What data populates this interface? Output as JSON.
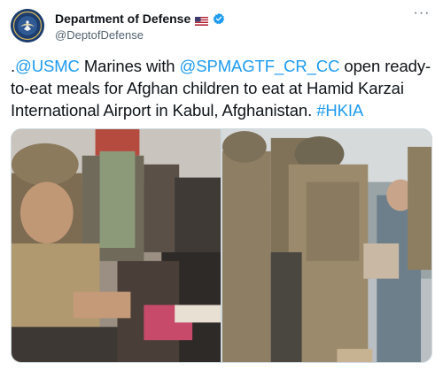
{
  "account": {
    "display_name": "Department of Defense",
    "handle": "@DeptofDefense",
    "avatar_icon": "dod-seal-icon",
    "flag_icon": "us-flag-icon",
    "verified_icon": "verified-badge-icon",
    "verified_color": "#1d9bf0"
  },
  "menu": {
    "more_icon": "more-dots-icon",
    "more_label": "···"
  },
  "tweet": {
    "segments": [
      {
        "text": ".",
        "link": false
      },
      {
        "text": "@USMC",
        "link": true
      },
      {
        "text": " Marines with ",
        "link": false
      },
      {
        "text": "@SPMAGTF_CR_CC",
        "link": true
      },
      {
        "text": " open ready-to-eat meals for Afghan children to eat at Hamid Karzai International Airport in Kabul, Afghanistan. ",
        "link": false
      },
      {
        "text": "#HKIA",
        "link": true
      }
    ],
    "link_color": "#1d9bf0"
  },
  "media": {
    "photo_count": 2
  }
}
